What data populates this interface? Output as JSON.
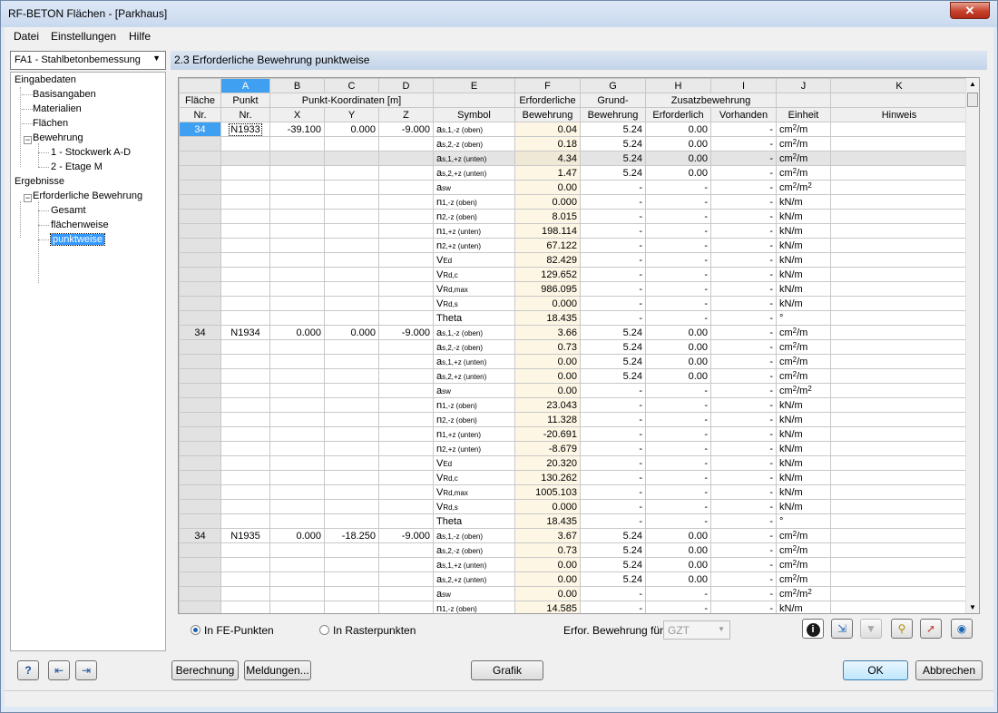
{
  "window": {
    "title": "RF-BETON Flächen - [Parkhaus]",
    "close": "✕"
  },
  "menu": [
    "Datei",
    "Einstellungen",
    "Hilfe"
  ],
  "case_select": "FA1 - Stahlbetonbemessung",
  "tree": [
    {
      "label": "Eingabedaten",
      "level": 0,
      "box": ""
    },
    {
      "label": "Basisangaben",
      "level": 1,
      "box": ""
    },
    {
      "label": "Materialien",
      "level": 1,
      "box": ""
    },
    {
      "label": "Flächen",
      "level": 1,
      "box": ""
    },
    {
      "label": "Bewehrung",
      "level": 1,
      "box": "−"
    },
    {
      "label": "1 - Stockwerk A-D",
      "level": 2,
      "box": ""
    },
    {
      "label": "2 - Etage M",
      "level": 2,
      "box": ""
    },
    {
      "label": "Ergebnisse",
      "level": 0,
      "box": ""
    },
    {
      "label": "Erforderliche Bewehrung",
      "level": 1,
      "box": "−"
    },
    {
      "label": "Gesamt",
      "level": 2,
      "box": ""
    },
    {
      "label": "flächenweise",
      "level": 2,
      "box": ""
    },
    {
      "label": "punktweise",
      "level": 2,
      "box": "",
      "selected": true
    }
  ],
  "panel_title": "2.3 Erforderliche Bewehrung punktweise",
  "table": {
    "col_letters": [
      "A",
      "B",
      "C",
      "D",
      "E",
      "F",
      "G",
      "H",
      "I",
      "J",
      "K"
    ],
    "header1": {
      "flaeche": "Fläche",
      "punkt": "Punkt",
      "koord": "Punkt-Koordinaten [m]",
      "erf": "Erforderliche",
      "grund": "Grund-",
      "zusatz": "Zusatzbewehrung"
    },
    "header2": {
      "nr": "Nr.",
      "punkt_nr": "Nr.",
      "x": "X",
      "y": "Y",
      "z": "Z",
      "symbol": "Symbol",
      "bewehrung": "Bewehrung",
      "bewehrung2": "Bewehrung",
      "erforderlich": "Erforderlich",
      "vorhanden": "Vorhanden",
      "einheit": "Einheit",
      "hinweis": "Hinweis"
    },
    "groups": [
      {
        "flaeche": "34",
        "punkt": "N1933",
        "x": "-39.100",
        "y": "0.000",
        "z": "-9.000",
        "rows": [
          {
            "sym": "a",
            "sub": "s,1,-z (oben)",
            "f": "0.04",
            "g": "5.24",
            "h": "0.00",
            "i": "-",
            "unit": "cm",
            "usup": "2",
            "urest": "/m"
          },
          {
            "sym": "a",
            "sub": "s,2,-z (oben)",
            "f": "0.18",
            "g": "5.24",
            "h": "0.00",
            "i": "-",
            "unit": "cm",
            "usup": "2",
            "urest": "/m"
          },
          {
            "sym": "a",
            "sub": "s,1,+z (unten)",
            "f": "4.34",
            "g": "5.24",
            "h": "0.00",
            "i": "-",
            "unit": "cm",
            "usup": "2",
            "urest": "/m",
            "gray": true
          },
          {
            "sym": "a",
            "sub": "s,2,+z (unten)",
            "f": "1.47",
            "g": "5.24",
            "h": "0.00",
            "i": "-",
            "unit": "cm",
            "usup": "2",
            "urest": "/m"
          },
          {
            "sym": "a",
            "sub": "sw",
            "f": "0.00",
            "g": "-",
            "h": "-",
            "i": "-",
            "unit": "cm",
            "usup": "2",
            "urest": "/m",
            "usup2": "2"
          },
          {
            "sym": "n",
            "sub": "1,-z (oben)",
            "f": "0.000",
            "g": "-",
            "h": "-",
            "i": "-",
            "unit": "kN/m"
          },
          {
            "sym": "n",
            "sub": "2,-z (oben)",
            "f": "8.015",
            "g": "-",
            "h": "-",
            "i": "-",
            "unit": "kN/m"
          },
          {
            "sym": "n",
            "sub": "1,+z (unten)",
            "f": "198.114",
            "g": "-",
            "h": "-",
            "i": "-",
            "unit": "kN/m"
          },
          {
            "sym": "n",
            "sub": "2,+z (unten)",
            "f": "67.122",
            "g": "-",
            "h": "-",
            "i": "-",
            "unit": "kN/m"
          },
          {
            "sym": "V",
            "sub": "Ed",
            "f": "82.429",
            "g": "-",
            "h": "-",
            "i": "-",
            "unit": "kN/m"
          },
          {
            "sym": "V",
            "sub": "Rd,c",
            "f": "129.652",
            "g": "-",
            "h": "-",
            "i": "-",
            "unit": "kN/m"
          },
          {
            "sym": "V",
            "sub": "Rd,max",
            "f": "986.095",
            "g": "-",
            "h": "-",
            "i": "-",
            "unit": "kN/m"
          },
          {
            "sym": "V",
            "sub": "Rd,s",
            "f": "0.000",
            "g": "-",
            "h": "-",
            "i": "-",
            "unit": "kN/m"
          },
          {
            "sym": "Theta",
            "sub": "",
            "f": "18.435",
            "g": "-",
            "h": "-",
            "i": "-",
            "unit": "°"
          }
        ]
      },
      {
        "flaeche": "34",
        "punkt": "N1934",
        "x": "0.000",
        "y": "0.000",
        "z": "-9.000",
        "rows": [
          {
            "sym": "a",
            "sub": "s,1,-z (oben)",
            "f": "3.66",
            "g": "5.24",
            "h": "0.00",
            "i": "-",
            "unit": "cm",
            "usup": "2",
            "urest": "/m"
          },
          {
            "sym": "a",
            "sub": "s,2,-z (oben)",
            "f": "0.73",
            "g": "5.24",
            "h": "0.00",
            "i": "-",
            "unit": "cm",
            "usup": "2",
            "urest": "/m"
          },
          {
            "sym": "a",
            "sub": "s,1,+z (unten)",
            "f": "0.00",
            "g": "5.24",
            "h": "0.00",
            "i": "-",
            "unit": "cm",
            "usup": "2",
            "urest": "/m"
          },
          {
            "sym": "a",
            "sub": "s,2,+z (unten)",
            "f": "0.00",
            "g": "5.24",
            "h": "0.00",
            "i": "-",
            "unit": "cm",
            "usup": "2",
            "urest": "/m"
          },
          {
            "sym": "a",
            "sub": "sw",
            "f": "0.00",
            "g": "-",
            "h": "-",
            "i": "-",
            "unit": "cm",
            "usup": "2",
            "urest": "/m",
            "usup2": "2"
          },
          {
            "sym": "n",
            "sub": "1,-z (oben)",
            "f": "23.043",
            "g": "-",
            "h": "-",
            "i": "-",
            "unit": "kN/m"
          },
          {
            "sym": "n",
            "sub": "2,-z (oben)",
            "f": "11.328",
            "g": "-",
            "h": "-",
            "i": "-",
            "unit": "kN/m"
          },
          {
            "sym": "n",
            "sub": "1,+z (unten)",
            "f": "-20.691",
            "g": "-",
            "h": "-",
            "i": "-",
            "unit": "kN/m"
          },
          {
            "sym": "n",
            "sub": "2,+z (unten)",
            "f": "-8.679",
            "g": "-",
            "h": "-",
            "i": "-",
            "unit": "kN/m"
          },
          {
            "sym": "V",
            "sub": "Ed",
            "f": "20.320",
            "g": "-",
            "h": "-",
            "i": "-",
            "unit": "kN/m"
          },
          {
            "sym": "V",
            "sub": "Rd,c",
            "f": "130.262",
            "g": "-",
            "h": "-",
            "i": "-",
            "unit": "kN/m"
          },
          {
            "sym": "V",
            "sub": "Rd,max",
            "f": "1005.103",
            "g": "-",
            "h": "-",
            "i": "-",
            "unit": "kN/m"
          },
          {
            "sym": "V",
            "sub": "Rd,s",
            "f": "0.000",
            "g": "-",
            "h": "-",
            "i": "-",
            "unit": "kN/m"
          },
          {
            "sym": "Theta",
            "sub": "",
            "f": "18.435",
            "g": "-",
            "h": "-",
            "i": "-",
            "unit": "°"
          }
        ]
      },
      {
        "flaeche": "34",
        "punkt": "N1935",
        "x": "0.000",
        "y": "-18.250",
        "z": "-9.000",
        "rows": [
          {
            "sym": "a",
            "sub": "s,1,-z (oben)",
            "f": "3.67",
            "g": "5.24",
            "h": "0.00",
            "i": "-",
            "unit": "cm",
            "usup": "2",
            "urest": "/m"
          },
          {
            "sym": "a",
            "sub": "s,2,-z (oben)",
            "f": "0.73",
            "g": "5.24",
            "h": "0.00",
            "i": "-",
            "unit": "cm",
            "usup": "2",
            "urest": "/m"
          },
          {
            "sym": "a",
            "sub": "s,1,+z (unten)",
            "f": "0.00",
            "g": "5.24",
            "h": "0.00",
            "i": "-",
            "unit": "cm",
            "usup": "2",
            "urest": "/m"
          },
          {
            "sym": "a",
            "sub": "s,2,+z (unten)",
            "f": "0.00",
            "g": "5.24",
            "h": "0.00",
            "i": "-",
            "unit": "cm",
            "usup": "2",
            "urest": "/m"
          },
          {
            "sym": "a",
            "sub": "sw",
            "f": "0.00",
            "g": "-",
            "h": "-",
            "i": "-",
            "unit": "cm",
            "usup": "2",
            "urest": "/m",
            "usup2": "2"
          },
          {
            "sym": "n",
            "sub": "1,-z (oben)",
            "f": "14.585",
            "g": "-",
            "h": "-",
            "i": "-",
            "unit": "kN/m"
          }
        ]
      }
    ]
  },
  "options": {
    "radio1": "In FE-Punkten",
    "radio2": "In Rasterpunkten",
    "erfor_label": "Erfor. Bewehrung für:",
    "erfor_value": "GZT"
  },
  "buttons": {
    "berechnung": "Berechnung",
    "meldungen": "Meldungen...",
    "grafik": "Grafik",
    "ok": "OK",
    "abbrechen": "Abbrechen"
  }
}
